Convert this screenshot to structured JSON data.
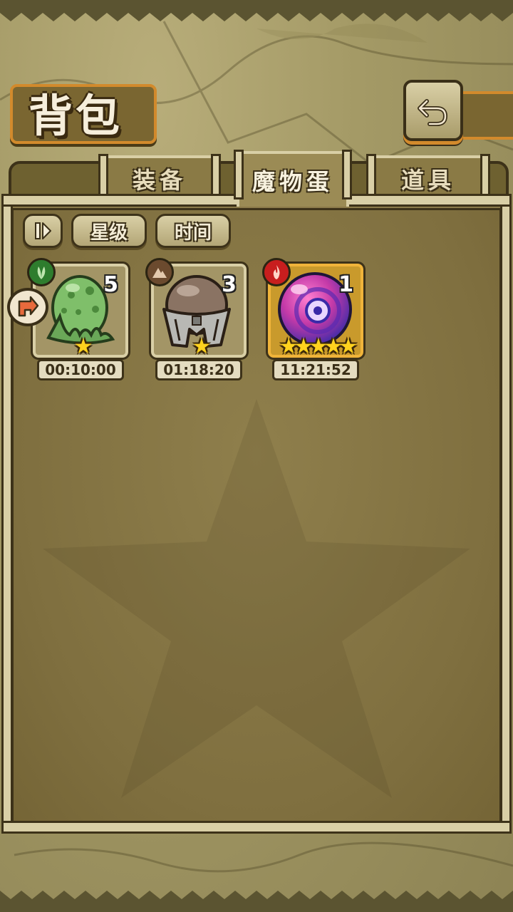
{
  "header": {
    "title": "背包",
    "back_button_icon": "back-arrow-icon"
  },
  "tabs": [
    {
      "label": "装备",
      "active": false
    },
    {
      "label": "魔物蛋",
      "active": true
    },
    {
      "label": "道具",
      "active": false
    }
  ],
  "sort": {
    "toggle_icon": "sort-toggle-icon",
    "star_label": "星级",
    "time_label": "时间"
  },
  "eggs": [
    {
      "element": "grass",
      "element_icon": "leaf-icon",
      "element_color": "#2e7d2e",
      "count": "5",
      "stars": 1,
      "time": "00:10:00",
      "name": "green-slime-egg",
      "highlighted": false,
      "new_tag": true
    },
    {
      "element": "earth",
      "element_icon": "mountain-icon",
      "element_color": "#6b4a2e",
      "count": "3",
      "stars": 1,
      "time": "01:18:20",
      "name": "helmet-egg",
      "highlighted": false,
      "new_tag": false
    },
    {
      "element": "fire",
      "element_icon": "flame-icon",
      "element_color": "#c81e1e",
      "count": "1",
      "stars": 5,
      "time": "11:21:52",
      "name": "pink-orb-egg",
      "highlighted": true,
      "new_tag": false
    }
  ],
  "colors": {
    "accent_orange": "#d28a2c",
    "parchment": "#d9cfa6",
    "dark_brown": "#3d3219",
    "star_yellow": "#ffd21e"
  }
}
